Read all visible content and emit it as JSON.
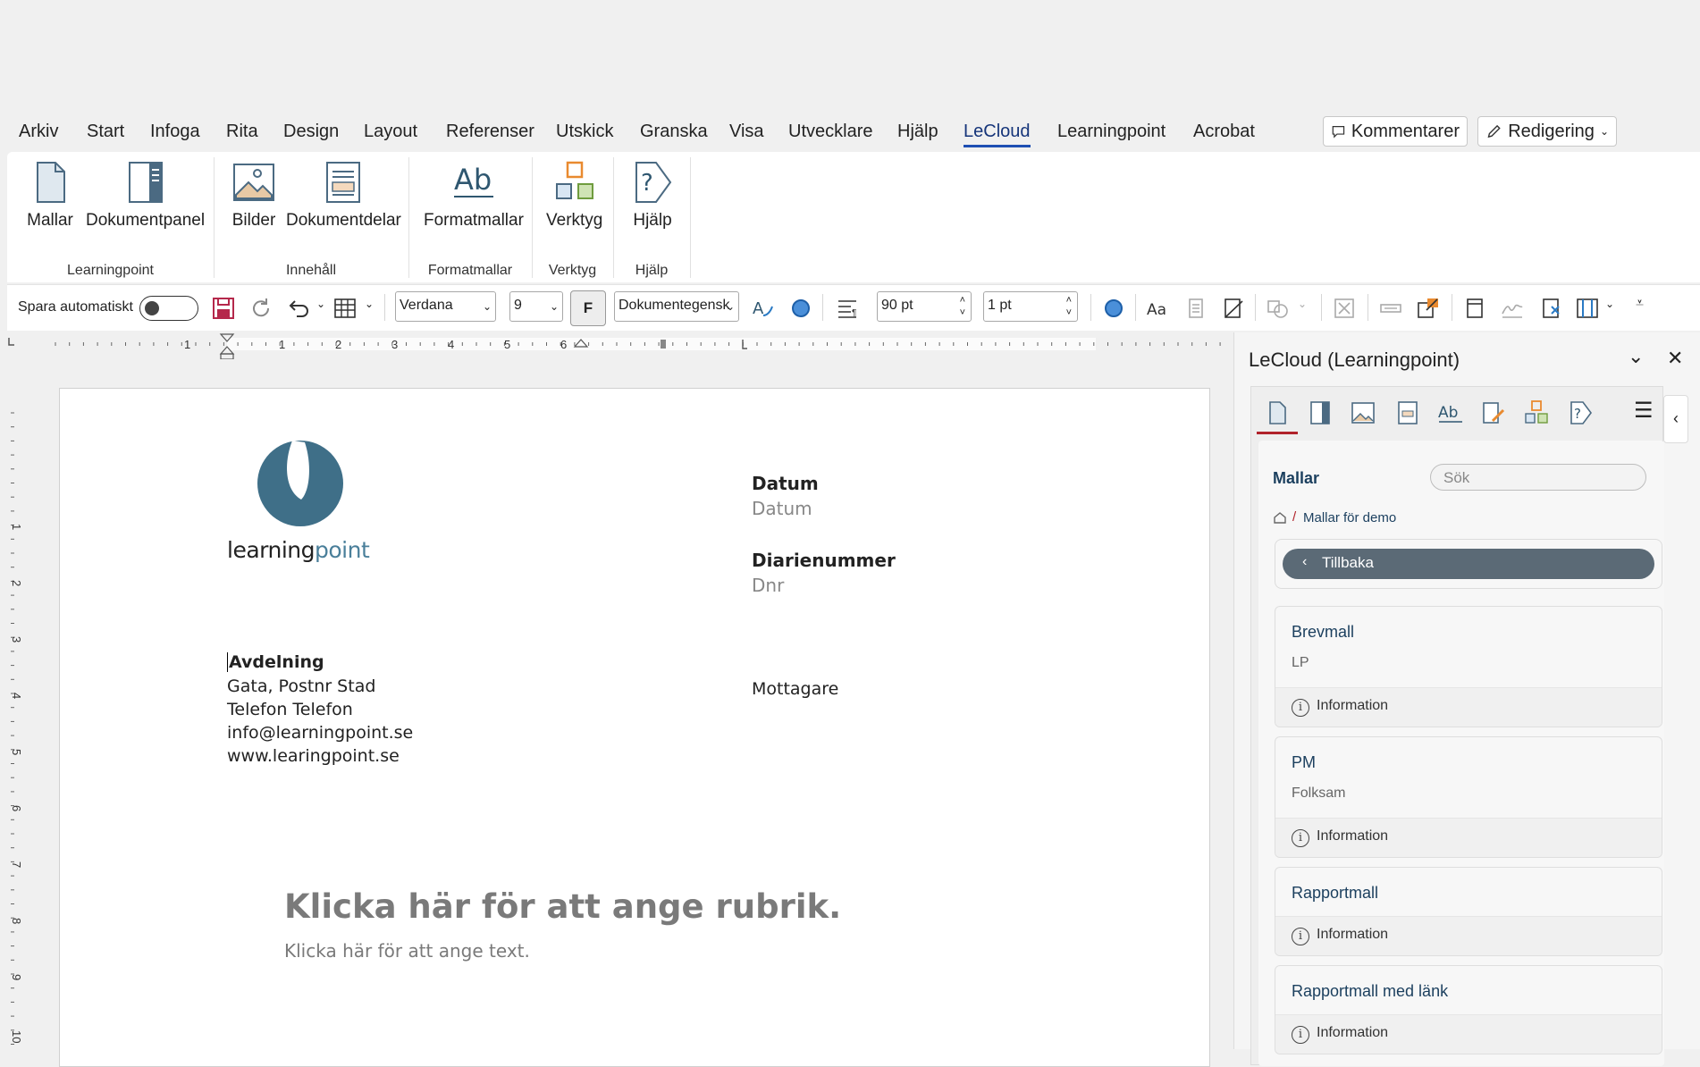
{
  "menu": {
    "tabs": [
      "Arkiv",
      "Start",
      "Infoga",
      "Rita",
      "Design",
      "Layout",
      "Referenser",
      "Utskick",
      "Granska",
      "Visa",
      "Utvecklare",
      "Hjälp",
      "LeCloud",
      "Learningpoint",
      "Acrobat"
    ],
    "active": "LeCloud",
    "comments_label": "Kommentarer",
    "editing_label": "Redigering"
  },
  "ribbon": {
    "buttons": {
      "mallar": "Mallar",
      "dokumentpanel": "Dokumentpanel",
      "bilder": "Bilder",
      "dokumentdelar": "Dokumentdelar",
      "formatmallar": "Formatmallar",
      "verktyg": "Verktyg",
      "hjalp": "Hjälp"
    },
    "groups": {
      "learningpoint": "Learningpoint",
      "innehall": "Innehåll",
      "formatmallar": "Formatmallar",
      "verktyg": "Verktyg",
      "hjalp": "Hjälp"
    }
  },
  "toolbar": {
    "autosave_label": "Spara automatiskt",
    "font": "Verdana",
    "size": "9",
    "bold_label": "F",
    "style": "Dokumentegensk",
    "spacing1": "90 pt",
    "spacing2": "1 pt"
  },
  "ruler": {
    "h_numbers": [
      "1",
      "1",
      "2",
      "3",
      "4",
      "5",
      "6"
    ],
    "v_numbers": [
      "1",
      "2",
      "3",
      "4",
      "5",
      "6",
      "7",
      "8",
      "9",
      "10"
    ]
  },
  "document": {
    "logo_text_dark": "learning",
    "logo_text_light": "point",
    "datum_label": "Datum",
    "datum_value": "Datum",
    "diarie_label": "Diarienummer",
    "diarie_value": "Dnr",
    "avdelning": "Avdelning",
    "address": "Gata, Postnr Stad",
    "phone": "Telefon Telefon",
    "email": "info@learningpoint.se",
    "web": "www.learingpoint.se",
    "mottagare": "Mottagare",
    "heading": "Klicka här för att ange rubrik.",
    "body": "Klicka här för att ange text."
  },
  "pane": {
    "title": "LeCloud (Learningpoint)",
    "section": "Mallar",
    "search_placeholder": "Sök",
    "breadcrumb": "Mallar för demo",
    "back_label": "Tillbaka",
    "cards": [
      {
        "title": "Brevmall",
        "sub": "LP",
        "info": "Information"
      },
      {
        "title": "PM",
        "sub": "Folksam",
        "info": "Information"
      },
      {
        "title": "Rapportmall",
        "info": "Information"
      },
      {
        "title": "Rapportmall med länk",
        "info": "Information"
      }
    ]
  },
  "colors": {
    "accent": "#1e4fb3",
    "logo": "#3f6f88",
    "back_button": "#5b6a76",
    "pane_tab_underline": "#b0222a"
  }
}
